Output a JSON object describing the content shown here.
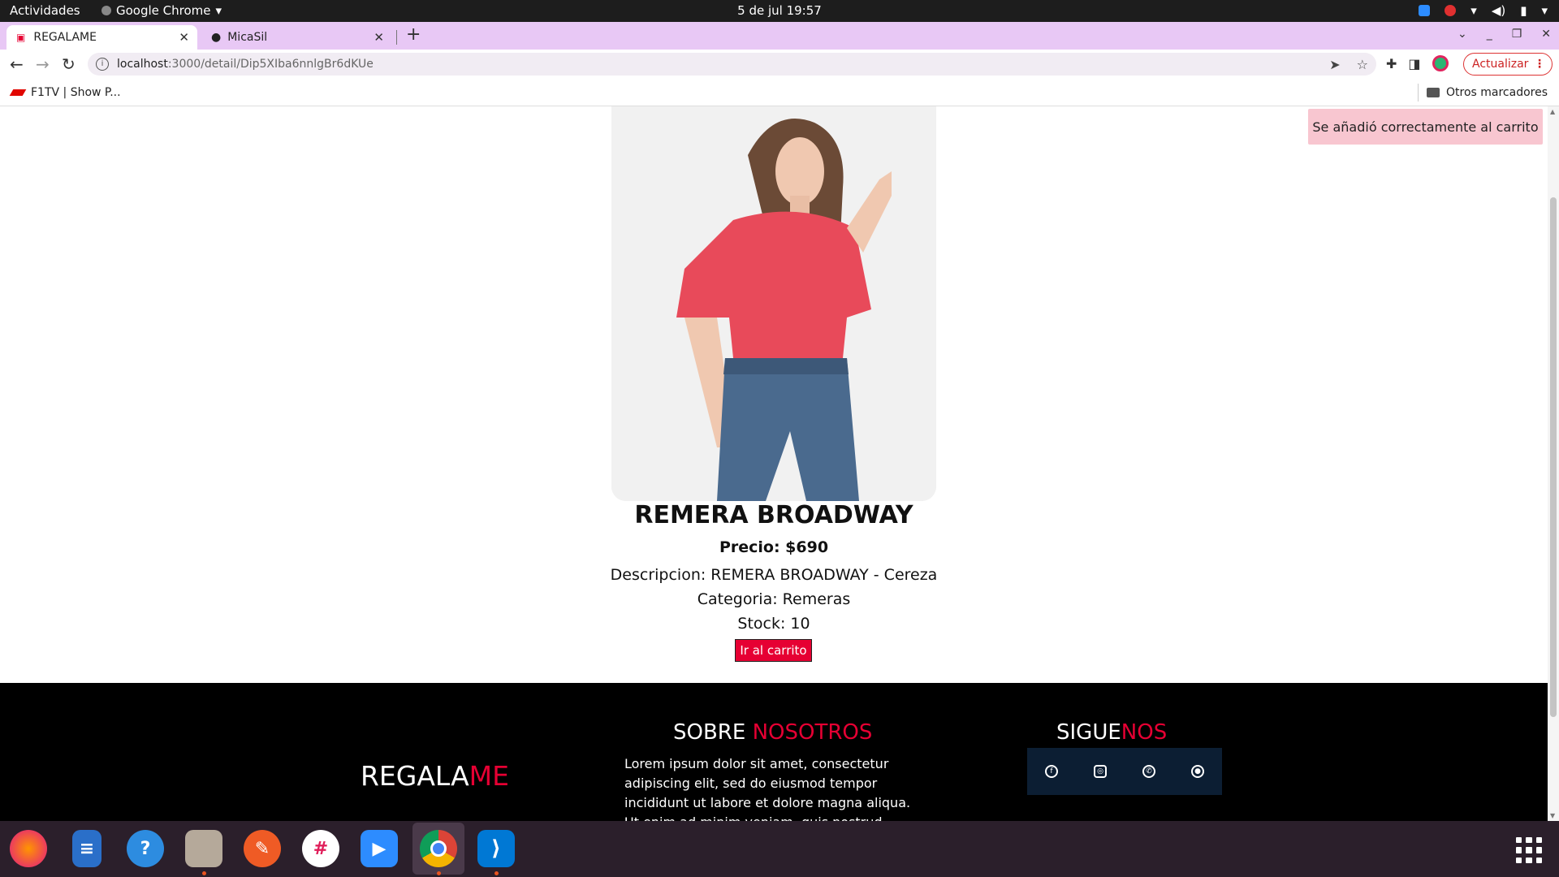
{
  "system": {
    "activities": "Actividades",
    "app_name": "Google Chrome",
    "clock": "5 de jul  19:57"
  },
  "tabs": [
    {
      "label": "REGALAME",
      "active": true
    },
    {
      "label": "MicaSil",
      "active": false
    }
  ],
  "address": {
    "host": "localhost",
    "path": ":3000/detail/Dip5XIba6nnlgBr6dKUe"
  },
  "update_button": "Actualizar",
  "bookmarks": {
    "item1": "F1TV | Show P...",
    "others": "Otros marcadores"
  },
  "toast": "Se añadió correctamente al carrito",
  "product": {
    "title": "REMERA BROADWAY",
    "price": "Precio: $690",
    "description": "Descripcion: REMERA BROADWAY - Cereza",
    "category": "Categoria: Remeras",
    "stock": "Stock: 10",
    "cart_button": "Ir al carrito"
  },
  "footer": {
    "brand_main": "REGALA",
    "brand_accent": "ME",
    "about_main": "SOBRE ",
    "about_accent": "NOSOTROS",
    "about_text": "Lorem ipsum dolor sit amet, consectetur adipiscing elit, sed do eiusmod tempor incididunt ut labore et dolore magna aliqua. Ut enim ad minim veniam, quis nostrud exercitation ullamco",
    "follow_main": "SIGUE",
    "follow_accent": "NOS",
    "social": [
      "facebook",
      "instagram",
      "whatsapp",
      "github"
    ]
  },
  "colors": {
    "accent": "#e60033",
    "tabbar": "#e8c8f5",
    "toast_bg": "#f8c6d0",
    "footer_bg": "#000000",
    "social_bg": "#0c1e33"
  },
  "dock": [
    "firefox",
    "libreoffice-writer",
    "help",
    "files",
    "postman",
    "slack",
    "zoom",
    "chrome",
    "vscode"
  ]
}
